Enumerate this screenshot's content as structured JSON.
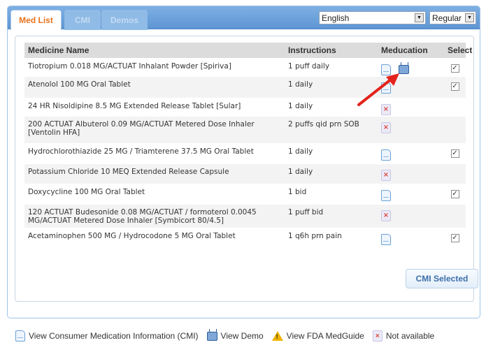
{
  "tabs": [
    {
      "label": "Med List",
      "active": true
    },
    {
      "label": "CMI",
      "active": false
    },
    {
      "label": "Demos",
      "active": false
    }
  ],
  "language_select": {
    "value": "English"
  },
  "font_select": {
    "value": "Regular"
  },
  "table": {
    "headers": [
      "Medicine Name",
      "Instructions",
      "Meducation",
      "Select"
    ],
    "rows": [
      {
        "name": "Tiotropium 0.018 MG/ACTUAT Inhalant Powder [Spiriva]",
        "instructions": "1 puff daily",
        "cmi": "available",
        "demo": true,
        "selected": true
      },
      {
        "name": "Atenolol 100 MG Oral Tablet",
        "instructions": "1 daily",
        "cmi": "available",
        "demo": false,
        "selected": true
      },
      {
        "name": "24 HR Nisoldipine 8.5 MG Extended Release Tablet [Sular]",
        "instructions": "1 daily",
        "cmi": "not-available",
        "demo": false,
        "selected": false
      },
      {
        "name": "200 ACTUAT Albuterol 0.09 MG/ACTUAT Metered Dose Inhaler [Ventolin HFA]",
        "instructions": "2 puffs qid prn SOB",
        "cmi": "not-available",
        "demo": false,
        "selected": false
      },
      {
        "name": "Hydrochlorothiazide 25 MG / Triamterene 37.5 MG Oral Tablet",
        "instructions": "1 daily",
        "cmi": "available",
        "demo": false,
        "selected": true
      },
      {
        "name": "Potassium Chloride 10 MEQ Extended Release Capsule",
        "instructions": "1 daily",
        "cmi": "not-available",
        "demo": false,
        "selected": false
      },
      {
        "name": "Doxycycline 100 MG Oral Tablet",
        "instructions": "1 bid",
        "cmi": "available",
        "demo": false,
        "selected": true
      },
      {
        "name": "120 ACTUAT Budesonide 0.08 MG/ACTUAT / formoterol 0.0045 MG/ACTUAT Metered Dose Inhaler [Symbicort 80/4.5]",
        "instructions": "1 puff bid",
        "cmi": "not-available",
        "demo": false,
        "selected": false
      },
      {
        "name": "Acetaminophen 500 MG / Hydrocodone 5 MG Oral Tablet",
        "instructions": "1 q6h prn pain",
        "cmi": "available",
        "demo": false,
        "selected": true
      }
    ]
  },
  "cmi_button": {
    "label": "CMI Selected"
  },
  "legend": {
    "cmi": "View Consumer Medication Information (CMI)",
    "demo": "View Demo",
    "medguide": "View FDA MedGuide",
    "na": "Not available"
  },
  "colors": {
    "active_tab_text": "#e8731e",
    "header_bar": "#6fa3dc",
    "annotation_arrow": "#e3231b"
  }
}
